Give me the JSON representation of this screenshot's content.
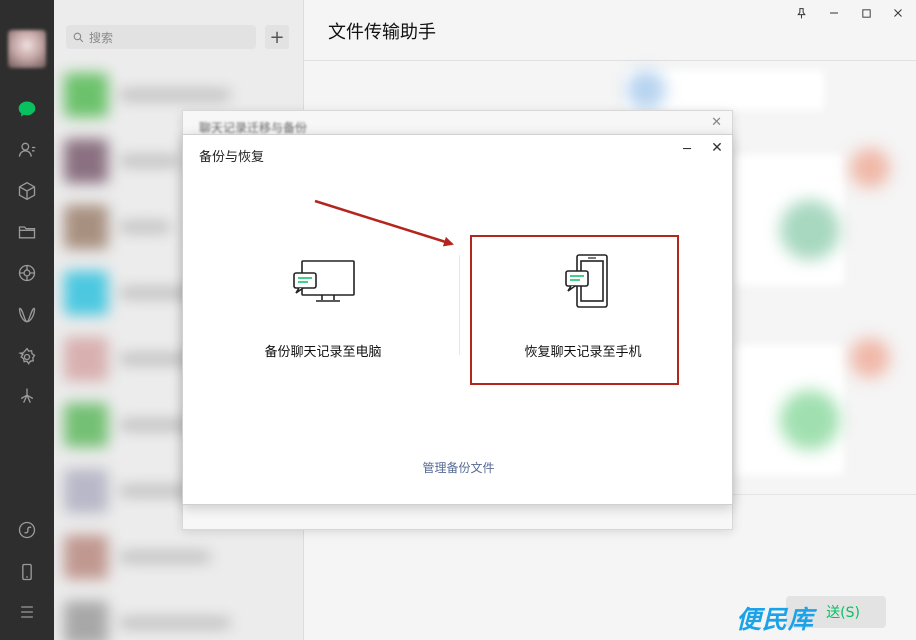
{
  "window": {
    "title": "文件传输助手",
    "pin_icon": "pin-icon",
    "minimize_icon": "minimize-icon",
    "maximize_icon": "maximize-icon",
    "close_icon": "close-icon"
  },
  "sidebar_icons": [
    "chat-icon",
    "contacts-icon",
    "box-icon",
    "folder-icon",
    "moments-icon",
    "channels-icon",
    "settings-gear-icon",
    "star-icon",
    "mini-program-icon",
    "phone-icon",
    "menu-icon"
  ],
  "search": {
    "placeholder": "搜索",
    "add_label": "+"
  },
  "background_dialog": {
    "title": "聊天记录迁移与备份",
    "close": "✕"
  },
  "dialog": {
    "title": "备份与恢复",
    "minimize": "─",
    "close": "✕",
    "options": [
      {
        "label": "备份聊天记录至电脑",
        "icon": "computer-chat-icon"
      },
      {
        "label": "恢复聊天记录至手机",
        "icon": "phone-chat-icon"
      }
    ],
    "manage_link": "管理备份文件"
  },
  "composer": {
    "send_label": "送(S)"
  },
  "watermark": "便民库",
  "colors": {
    "accent_green": "#07c160",
    "highlight_red": "#b3261e",
    "link_blue": "#576b95",
    "navbar": "#2e2e2e"
  }
}
